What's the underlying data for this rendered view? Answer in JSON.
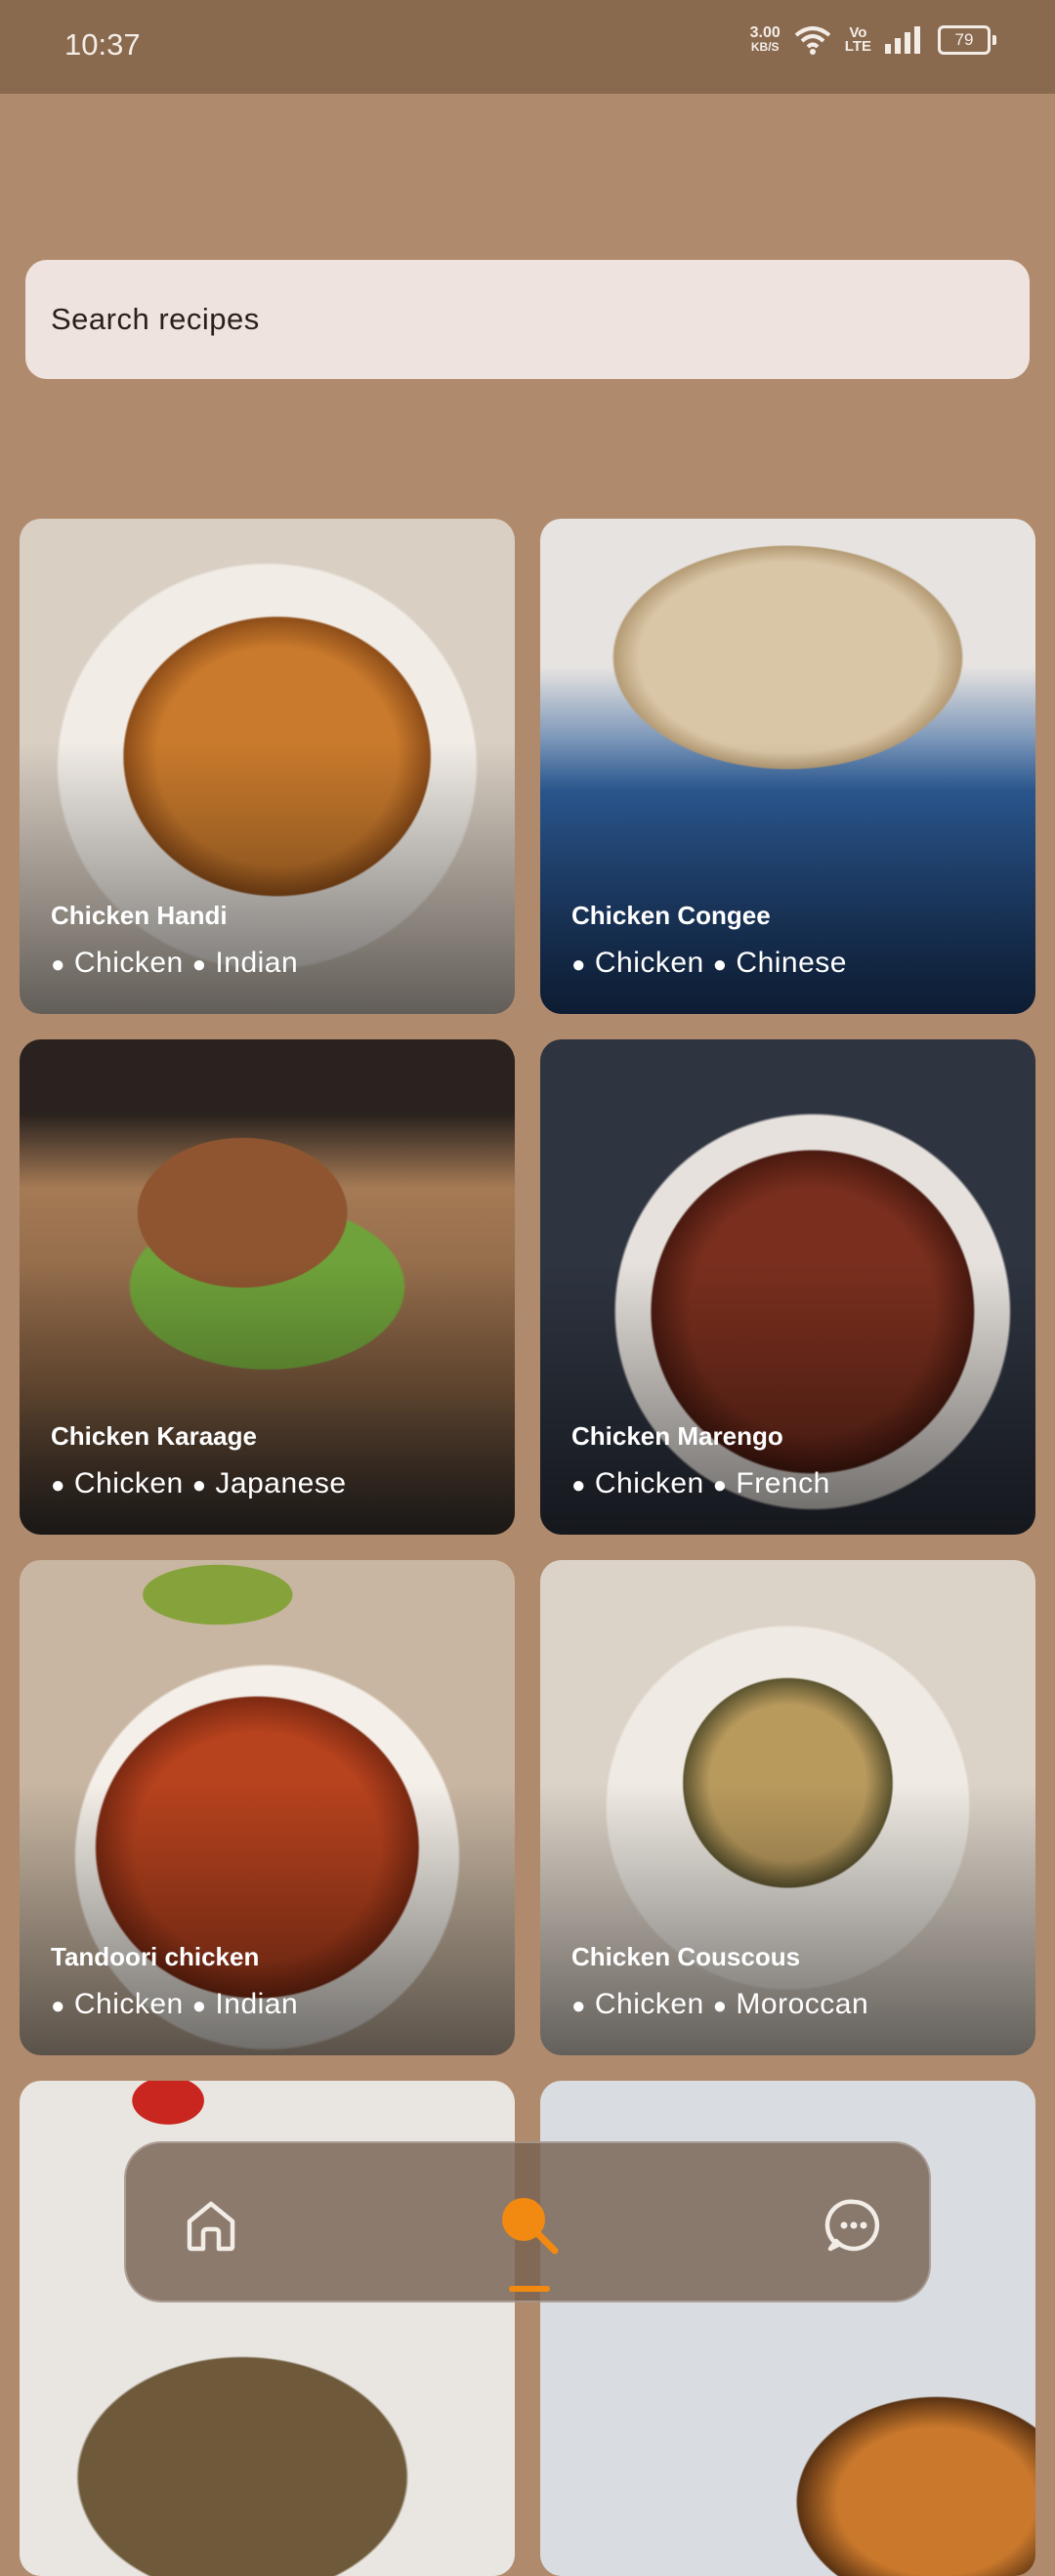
{
  "status_bar": {
    "time": "10:37",
    "net_speed_value": "3.00",
    "net_speed_unit": "KB/S",
    "volte_top": "Vo",
    "volte_bottom": "LTE",
    "battery": "79",
    "icons": [
      "wifi-icon",
      "volte-icon",
      "signal-icon",
      "battery-icon"
    ]
  },
  "search": {
    "placeholder": "Search recipes"
  },
  "recipes": [
    {
      "title": "Chicken Handi",
      "tags": [
        "Chicken",
        "Indian"
      ]
    },
    {
      "title": "Chicken Congee",
      "tags": [
        "Chicken",
        "Chinese"
      ]
    },
    {
      "title": "Chicken Karaage",
      "tags": [
        "Chicken",
        "Japanese"
      ]
    },
    {
      "title": "Chicken Marengo",
      "tags": [
        "Chicken",
        "French"
      ]
    },
    {
      "title": "Tandoori chicken",
      "tags": [
        "Chicken",
        "Indian"
      ]
    },
    {
      "title": "Chicken Couscous",
      "tags": [
        "Chicken",
        "Moroccan"
      ]
    }
  ],
  "bottom_nav": {
    "items": [
      "home-icon",
      "search-icon",
      "chat-icon"
    ],
    "active": "search",
    "accent_color": "#F28A12"
  },
  "colors": {
    "background": "#B08A6C",
    "status_bar": "#8A6A4E",
    "search_bg": "#EEE3DE"
  }
}
